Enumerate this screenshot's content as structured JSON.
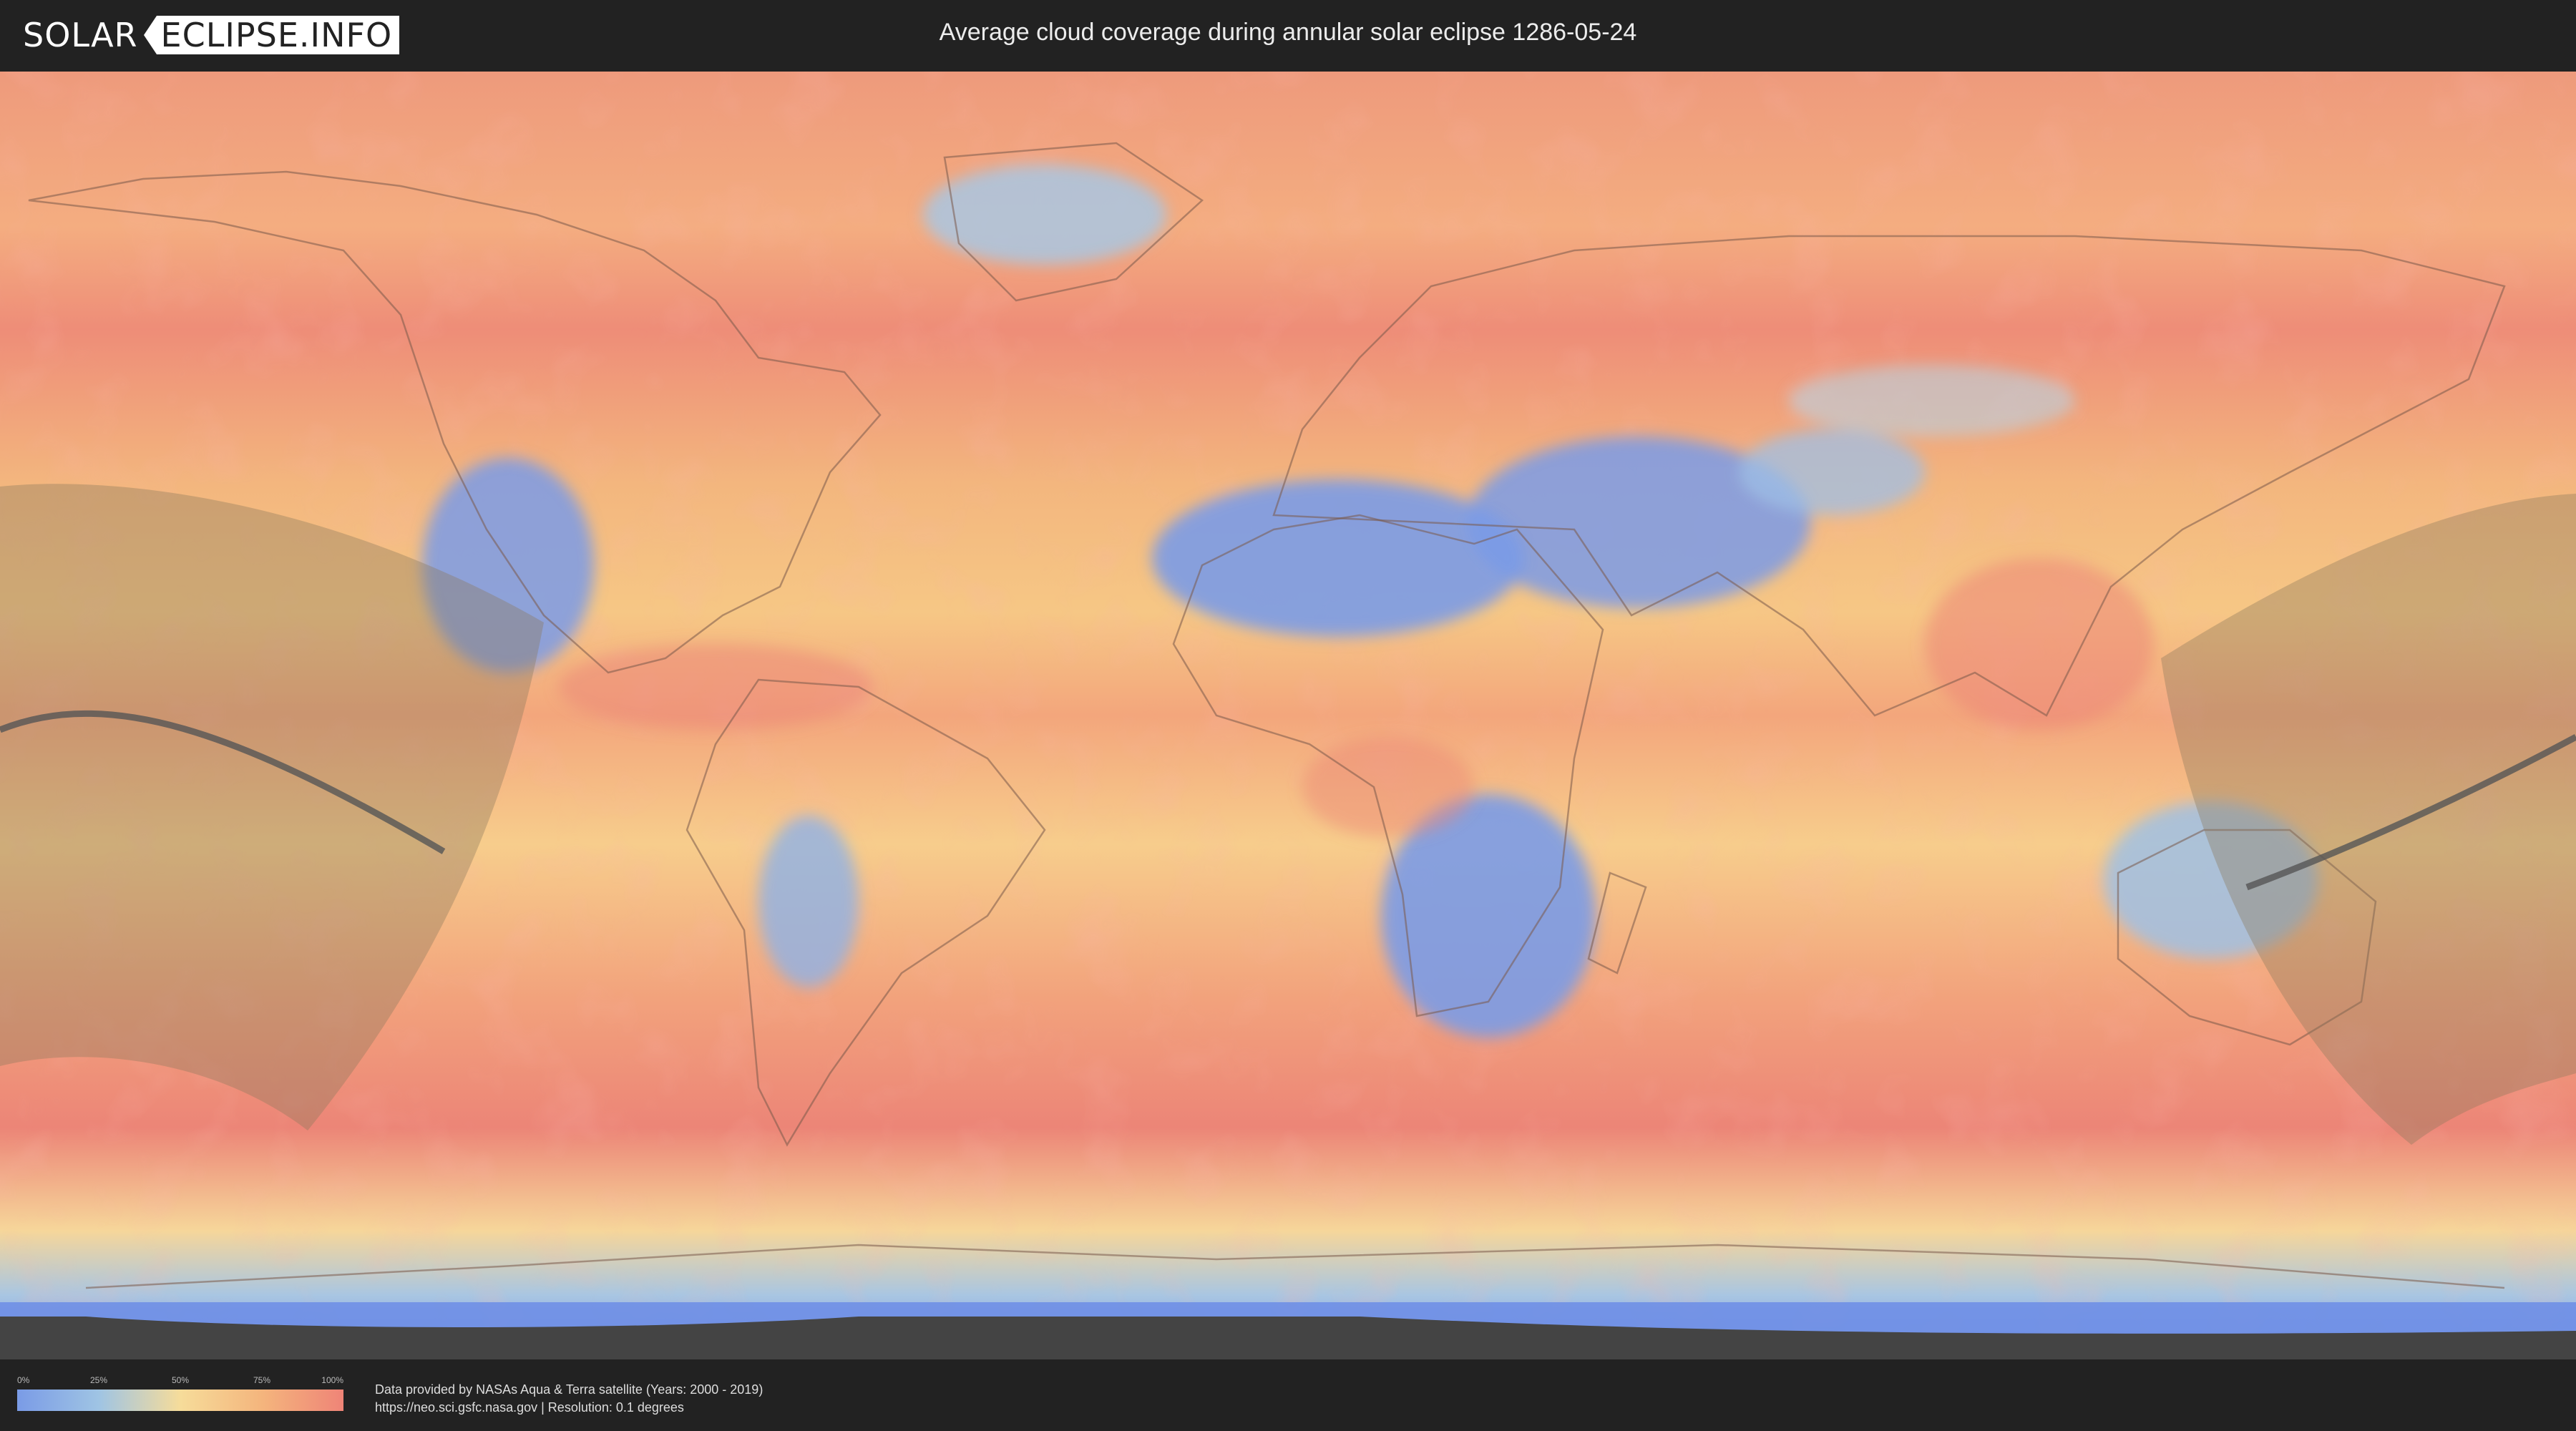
{
  "header": {
    "logo_left": "SOLAR",
    "logo_right": "ECLIPSE.INFO",
    "title": "Average cloud coverage during annular solar eclipse 1286-05-24"
  },
  "map": {
    "colors": {
      "clear": "#6f8fe6",
      "low": "#a9c6e2",
      "mid": "#f6d99a",
      "high": "#f2ae7e",
      "overcast": "#ec8577",
      "shadow_zone": "#8c7a5c",
      "path_line": "#555555"
    }
  },
  "legend": {
    "ticks": [
      "0%",
      "25%",
      "50%",
      "75%",
      "100%"
    ]
  },
  "footer": {
    "source_line": "Data provided by NASAs Aqua & Terra satellite (Years: 2000 - 2019)",
    "url_line": "https://neo.sci.gsfc.nasa.gov | Resolution: 0.1 degrees"
  }
}
